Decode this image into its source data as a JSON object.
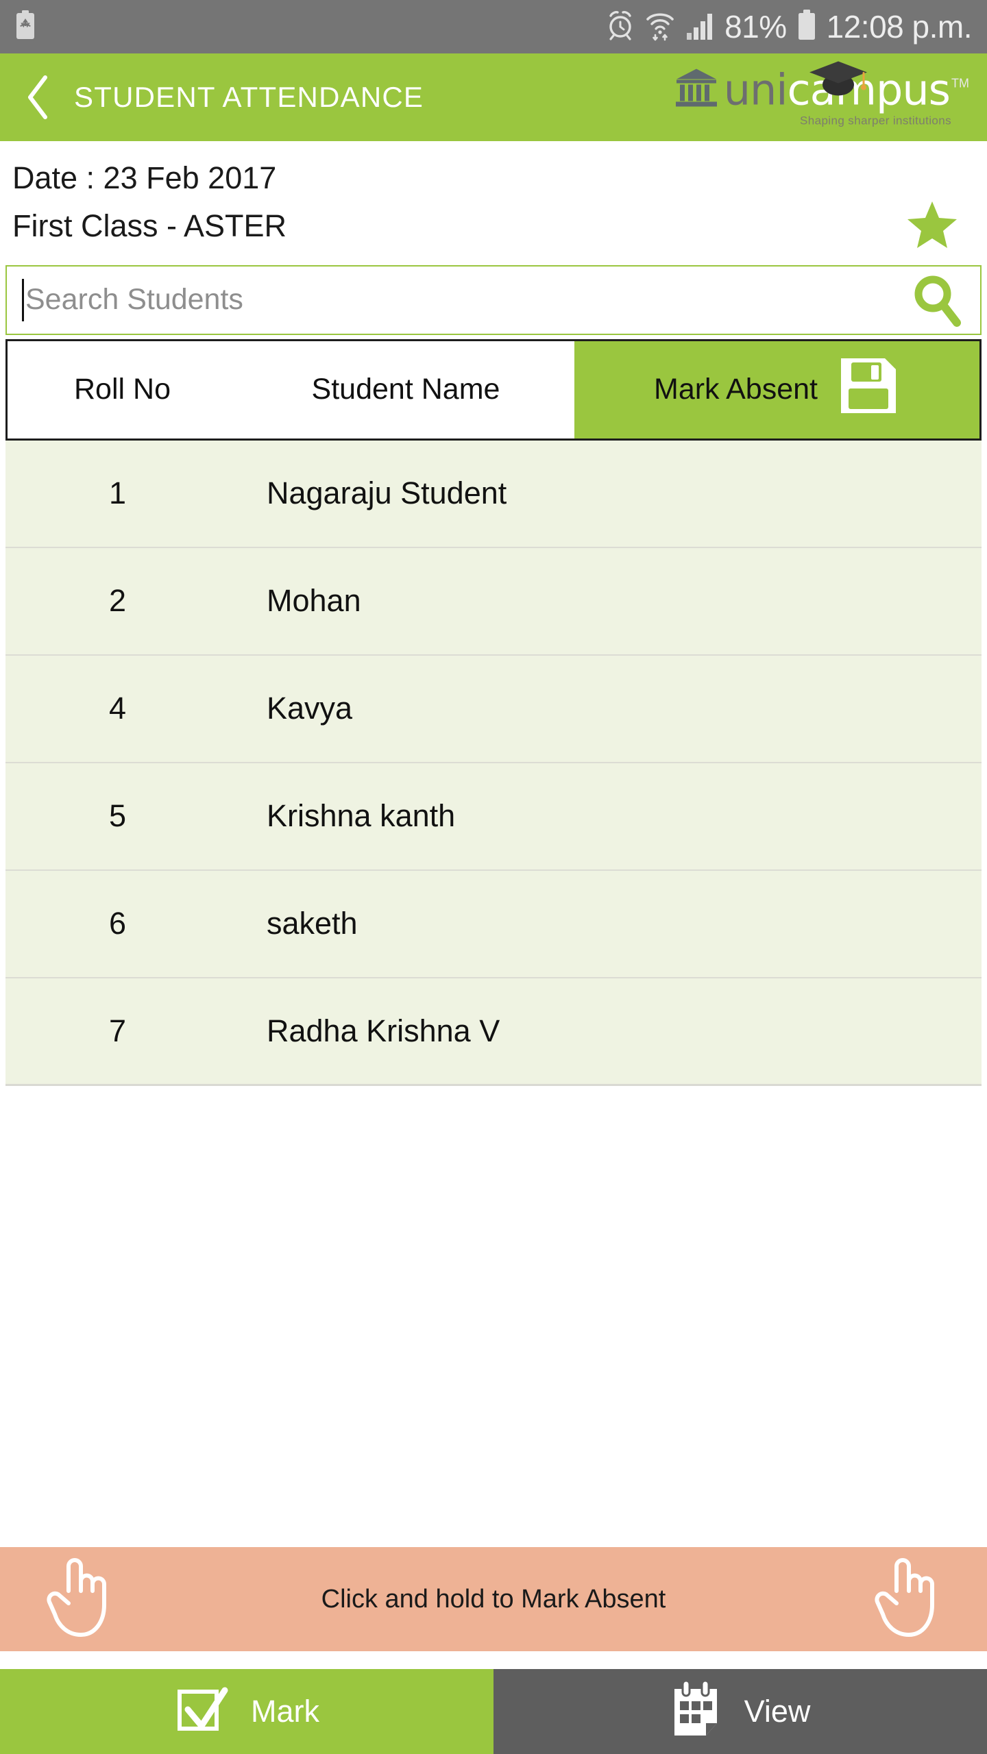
{
  "statusbar": {
    "battery_saver_icon": "battery-recycle-icon",
    "alarm_icon": "alarm-clock-icon",
    "wifi_icon": "wifi-icon",
    "signal_icon": "cellular-signal-icon",
    "battery_percent": "81%",
    "battery_icon": "battery-icon",
    "time": "12:08 p.m."
  },
  "appbar": {
    "back_icon": "back-chevron-icon",
    "title": "STUDENT ATTENDANCE",
    "logo": {
      "building_icon": "bank-building-icon",
      "cap_icon": "graduation-cap-icon",
      "word_uni": "uni",
      "word_cam": "cam",
      "word_pus": "us",
      "trademark": "TM",
      "tagline": "Shaping sharper institutions"
    }
  },
  "info": {
    "date_label": "Date : 23 Feb 2017",
    "class_label": "First Class - ASTER",
    "favorite_icon": "star-icon"
  },
  "search": {
    "value": "",
    "placeholder": "Search Students",
    "icon": "search-icon"
  },
  "table": {
    "headers": {
      "roll_no": "Roll No",
      "student_name": "Student Name",
      "mark_absent": "Mark Absent",
      "save_icon": "save-floppy-icon"
    },
    "rows": [
      {
        "roll_no": "1",
        "name": "Nagaraju Student"
      },
      {
        "roll_no": "2",
        "name": "Mohan"
      },
      {
        "roll_no": "4",
        "name": "Kavya"
      },
      {
        "roll_no": "5",
        "name": "Krishna kanth"
      },
      {
        "roll_no": "6",
        "name": "saketh"
      },
      {
        "roll_no": "7",
        "name": "Radha Krishna V"
      }
    ]
  },
  "hint": {
    "text": "Click and hold to Mark Absent",
    "left_icon": "pointing-hand-icon",
    "right_icon": "pointing-hand-icon"
  },
  "bottomnav": {
    "tabs": [
      {
        "label": "Mark",
        "icon": "checkbox-check-icon",
        "active": true
      },
      {
        "label": "View",
        "icon": "calendar-icon",
        "active": false
      }
    ]
  },
  "colors": {
    "brand_green": "#9ac63f",
    "row_bg": "#eff3e2",
    "hint_bg": "#eeb295",
    "statusbar_gray": "#757575",
    "inactive_tab_gray": "#5e5e5e"
  }
}
